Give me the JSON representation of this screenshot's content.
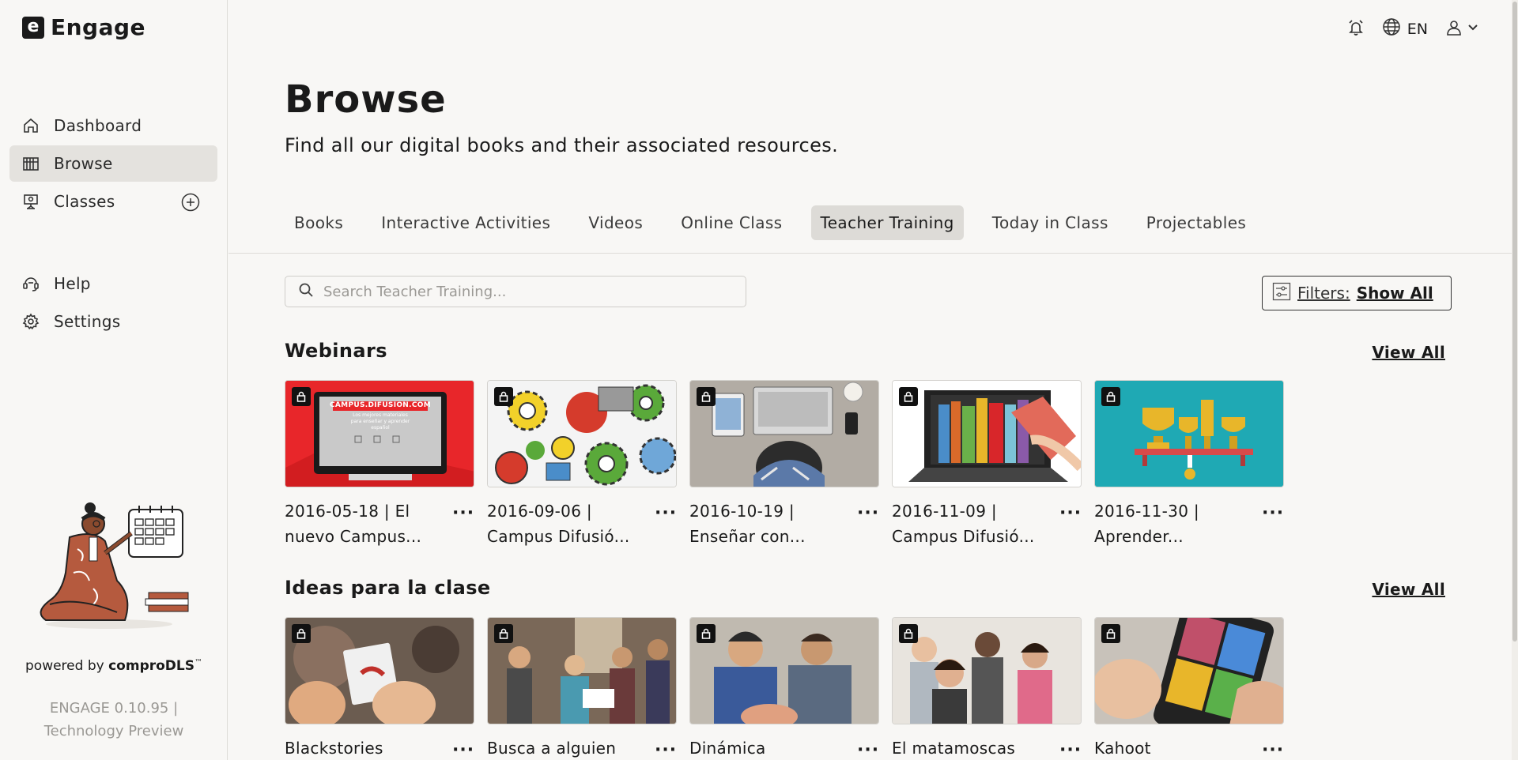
{
  "app": {
    "logo_letter": "e",
    "name": "Engage"
  },
  "sidebar": {
    "nav": [
      {
        "label": "Dashboard",
        "icon": "home-icon"
      },
      {
        "label": "Browse",
        "icon": "library-icon",
        "active": true
      },
      {
        "label": "Classes",
        "icon": "classroom-icon"
      }
    ],
    "nav_secondary": [
      {
        "label": "Help",
        "icon": "help-icon"
      },
      {
        "label": "Settings",
        "icon": "gear-icon"
      }
    ],
    "powered_prefix": "powered by ",
    "powered_brand": "comproDLS",
    "powered_tm": "™",
    "version_line1": "ENGAGE 0.10.95 |",
    "version_line2": "Technology Preview"
  },
  "topbar": {
    "language": "EN"
  },
  "page": {
    "title": "Browse",
    "subtitle": "Find all our digital books and their associated resources."
  },
  "tabs": [
    {
      "label": "Books"
    },
    {
      "label": "Interactive Activities"
    },
    {
      "label": "Videos"
    },
    {
      "label": "Online Class"
    },
    {
      "label": "Teacher Training",
      "active": true
    },
    {
      "label": "Today in Class"
    },
    {
      "label": "Projectables"
    }
  ],
  "search": {
    "placeholder": "Search Teacher Training...",
    "value": ""
  },
  "filters": {
    "label": "Filters:",
    "value": "Show All"
  },
  "sections": [
    {
      "title": "Webinars",
      "view_all": "View All",
      "items": [
        {
          "title": "2016-05-18 | El nuevo Campus..."
        },
        {
          "title": "2016-09-06 | Campus Difusió..."
        },
        {
          "title": "2016-10-19 | Enseñar con..."
        },
        {
          "title": "2016-11-09 | Campus Difusió..."
        },
        {
          "title": "2016-11-30 | Aprender..."
        }
      ]
    },
    {
      "title": "Ideas para la clase",
      "view_all": "View All",
      "items": [
        {
          "title": "Blackstories"
        },
        {
          "title": "Busca a alguien"
        },
        {
          "title": "Dinámica"
        },
        {
          "title": "El matamoscas"
        },
        {
          "title": "Kahoot"
        }
      ]
    }
  ],
  "thumb_texts": {
    "campus_banner": "CAMPUS.DIFUSION.COM",
    "campus_sub": "Los mejores materiales para enseñar y aprender español"
  },
  "colors": {
    "background": "#f8f7f5",
    "active_nav": "#e4e2de",
    "active_tab": "#dddbd7",
    "text": "#1a1a1a",
    "muted": "#9a9894"
  }
}
